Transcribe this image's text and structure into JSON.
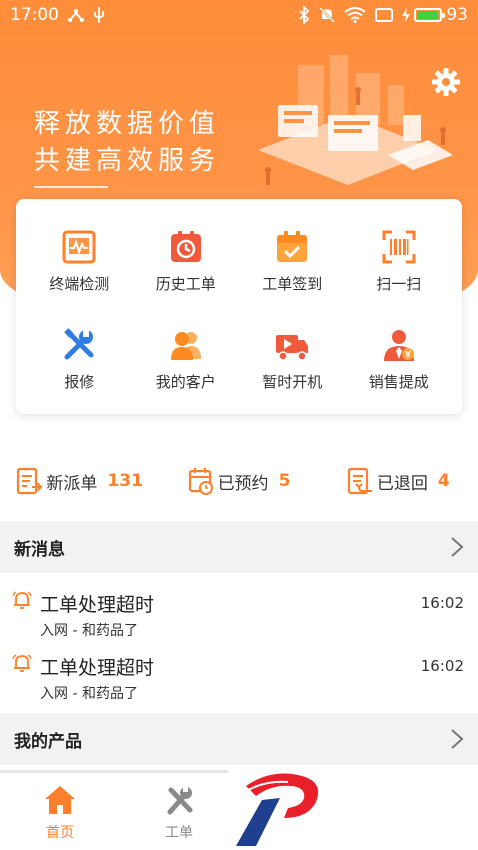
{
  "status_bar": {
    "time": "17:00",
    "battery": "93"
  },
  "header": {
    "slogan_line1": "释放数据价值",
    "slogan_line2": "共建高效服务"
  },
  "quick_actions": [
    {
      "label": "终端检测",
      "icon": "terminal-check-icon"
    },
    {
      "label": "历史工单",
      "icon": "history-order-icon"
    },
    {
      "label": "工单签到",
      "icon": "calendar-check-icon"
    },
    {
      "label": "扫一扫",
      "icon": "scan-icon"
    },
    {
      "label": "报修",
      "icon": "repair-tools-icon"
    },
    {
      "label": "我的客户",
      "icon": "customers-icon"
    },
    {
      "label": "暂时开机",
      "icon": "truck-play-icon"
    },
    {
      "label": "销售提成",
      "icon": "sales-commission-icon"
    }
  ],
  "counters": [
    {
      "label": "新派单",
      "value": "131"
    },
    {
      "label": "已预约",
      "value": "5"
    },
    {
      "label": "已退回",
      "value": "4"
    }
  ],
  "messages_section": {
    "title": "新消息"
  },
  "messages": [
    {
      "title": "工单处理超时",
      "subtitle": "入网 - 和药品了",
      "time": "16:02"
    },
    {
      "title": "工单处理超时",
      "subtitle": "入网 - 和药品了",
      "time": "16:02"
    }
  ],
  "products_section": {
    "title": "我的产品"
  },
  "bottom_nav": [
    {
      "label": "首页",
      "active": true
    },
    {
      "label": "工单",
      "active": false
    }
  ],
  "colors": {
    "accent": "#ff7f2a",
    "inactive": "#8a8a8a",
    "logo_red": "#e8202a",
    "logo_blue": "#1f3f8f"
  }
}
